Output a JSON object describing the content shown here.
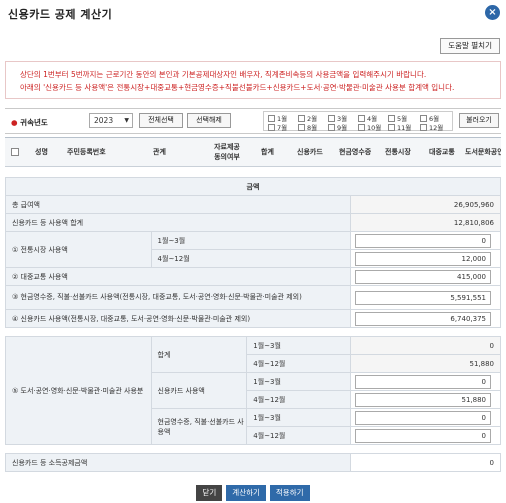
{
  "window": {
    "title": "신용카드 공제 계산기",
    "close_symbol": "×"
  },
  "help_button": "도움말 펼치기",
  "notice": {
    "line1": "상단의 1번부터 5번까지는 근로기간 동안의 본인과 기본공제대상자인 배우자, 직계존비속등의 사용금액을 입력해주시기 바랍니다.",
    "line2": "아래의 '신용카드 등 사용액'은 전통시장+대중교통+현금영수증+직불선불카드+신용카드+도서·공연·박물관·미술관 사용분 합계액 입니다."
  },
  "toolbar": {
    "year_label": "귀속년도",
    "year_value": "2023",
    "select_all": "전체선택",
    "deselect": "선택해제",
    "months": [
      "1월",
      "2월",
      "3월",
      "4월",
      "5월",
      "6월",
      "7월",
      "8월",
      "9월",
      "10월",
      "11월",
      "12월"
    ],
    "load": "불러오기"
  },
  "grid": {
    "columns": [
      "성명",
      "주민등록번호",
      "관계",
      "자료제공\n동의여부",
      "합계",
      "신용카드",
      "현금영수증",
      "전통시장",
      "대중교통",
      "도서문화공연"
    ]
  },
  "summary": {
    "header": "금액",
    "total_salary_label": "총 급여액",
    "total_salary": "26,905,960",
    "card_total_label": "신용카드 등 사용액 합계",
    "card_total": "12,810,806",
    "market_label": "① 전통시장 사용액",
    "market_h1_label": "1월~3월",
    "market_h1": "0",
    "market_h2_label": "4월~12월",
    "market_h2": "12,000",
    "transit_label": "② 대중교통 사용액",
    "transit": "415,000",
    "cash_label": "③ 현금영수증, 직불·선불카드 사용액(전통시장, 대중교통, 도서·공연·영화·신문·박물관·미술관 제외)",
    "cash": "5,591,551",
    "credit_label": "④ 신용카드 사용액(전통시장, 대중교통, 도서·공연·영화·신문·박물관·미술관 제외)",
    "credit": "6,740,375",
    "culture_label": "⑤ 도서·공연·영화·신문·박물관·미술관 사용분",
    "sum_label": "합계",
    "credit_card_label": "신용카드 사용액",
    "cash_card_label": "현금영수증, 직불·선불카드 사용액",
    "q1_label": "1월~3월",
    "q2_label": "4월~12월",
    "culture_sum_q1": "0",
    "culture_sum_q2": "51,880",
    "culture_credit_q1": "0",
    "culture_credit_q2": "51,880",
    "culture_cash_q1": "0",
    "culture_cash_q2": "0",
    "deduction_label": "신용카드 등 소득공제금액",
    "deduction": "0"
  },
  "buttons": {
    "close": "닫기",
    "calculate": "계산하기",
    "apply": "적용하기"
  }
}
